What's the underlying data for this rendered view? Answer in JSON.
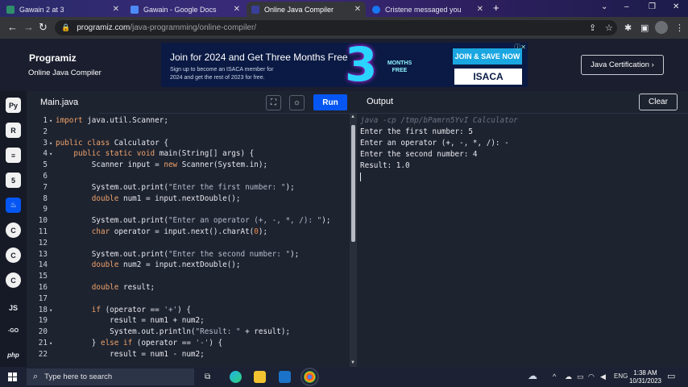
{
  "browser": {
    "tabs": [
      {
        "title": "Gawain 2 at 3",
        "color": "#2f8f6a"
      },
      {
        "title": "Gawain - Google Docs",
        "color": "#4c8bf5"
      },
      {
        "title": "Online Java Compiler",
        "color": "#3a3f9a"
      },
      {
        "title": "Cristene messaged you",
        "color": "#1877f2"
      }
    ],
    "url_domain": "programiz.com",
    "url_path": "/java-programming/online-compiler/"
  },
  "header": {
    "logo": "Programiz",
    "subtitle": "Online Java Compiler",
    "cert_button": "Java Certification ›"
  },
  "ad": {
    "headline": "Join for 2024 and Get Three Months Free",
    "line1": "Sign up to become an ISACA member for",
    "line2": "2024 and get the rest of 2023 for free.",
    "big_number": "3",
    "months_free": "MONTHS FREE",
    "join_button": "JOIN & SAVE NOW",
    "brand": "ISACA"
  },
  "sidebar": {
    "items": [
      {
        "name": "python",
        "label": "Py"
      },
      {
        "name": "r",
        "label": "R"
      },
      {
        "name": "sql",
        "label": "≡"
      },
      {
        "name": "html",
        "label": "5"
      },
      {
        "name": "java",
        "label": "♨"
      },
      {
        "name": "c",
        "label": "C"
      },
      {
        "name": "cpp",
        "label": "C"
      },
      {
        "name": "csharp",
        "label": "C"
      },
      {
        "name": "js",
        "label": "JS"
      },
      {
        "name": "go",
        "label": "-GO"
      },
      {
        "name": "php",
        "label": "php"
      }
    ]
  },
  "editor": {
    "file_tab": "Main.java",
    "run_label": "Run",
    "lines": [
      {
        "n": "1",
        "f": "▾",
        "html": "<span class='kw'>import</span> java.util.Scanner;"
      },
      {
        "n": "2",
        "f": "",
        "html": ""
      },
      {
        "n": "3",
        "f": "▾",
        "html": "<span class='kw'>public class</span> Calculator {"
      },
      {
        "n": "4",
        "f": "▾",
        "html": "    <span class='kw'>public static void</span> main(String[] args) {"
      },
      {
        "n": "5",
        "f": "",
        "html": "        Scanner input = <span class='kw'>new</span> Scanner(System.in);"
      },
      {
        "n": "6",
        "f": "",
        "html": ""
      },
      {
        "n": "7",
        "f": "",
        "html": "        System.out.print(<span class='str'>\"Enter the first number: \"</span>);"
      },
      {
        "n": "8",
        "f": "",
        "html": "        <span class='kw'>double</span> num1 = input.nextDouble();"
      },
      {
        "n": "9",
        "f": "",
        "html": ""
      },
      {
        "n": "10",
        "f": "",
        "html": "        System.out.print(<span class='str'>\"Enter an operator (+, -, *, /): \"</span>);"
      },
      {
        "n": "11",
        "f": "",
        "html": "        <span class='kw'>char</span> operator = input.next().charAt(<span class='num'>0</span>);"
      },
      {
        "n": "12",
        "f": "",
        "html": ""
      },
      {
        "n": "13",
        "f": "",
        "html": "        System.out.print(<span class='str'>\"Enter the second number: \"</span>);"
      },
      {
        "n": "14",
        "f": "",
        "html": "        <span class='kw'>double</span> num2 = input.nextDouble();"
      },
      {
        "n": "15",
        "f": "",
        "html": ""
      },
      {
        "n": "16",
        "f": "",
        "html": "        <span class='kw'>double</span> result;"
      },
      {
        "n": "17",
        "f": "",
        "html": ""
      },
      {
        "n": "18",
        "f": "▾",
        "html": "        <span class='kw'>if</span> (operator == <span class='str'>'+'</span>) {"
      },
      {
        "n": "19",
        "f": "",
        "html": "            result = num1 + num2;"
      },
      {
        "n": "20",
        "f": "",
        "html": "            System.out.println(<span class='str'>\"Result: \"</span> + result);"
      },
      {
        "n": "21",
        "f": "▾",
        "html": "        } <span class='kw'>else if</span> (operator == <span class='str'>'-'</span>) {"
      },
      {
        "n": "22",
        "f": "",
        "html": "            result = num1 - num2;"
      }
    ]
  },
  "output": {
    "title": "Output",
    "clear_label": "Clear",
    "command": "java -cp /tmp/bPamrn5YvI Calculator",
    "lines": [
      "Enter the first number: 5",
      "Enter an operator (+, -, *, /): -",
      "Enter the second number: 4",
      "Result: 1.0"
    ]
  },
  "taskbar": {
    "search_placeholder": "Type here to search",
    "language": "ENG",
    "time": "1:38 AM",
    "date": "10/31/2023"
  }
}
